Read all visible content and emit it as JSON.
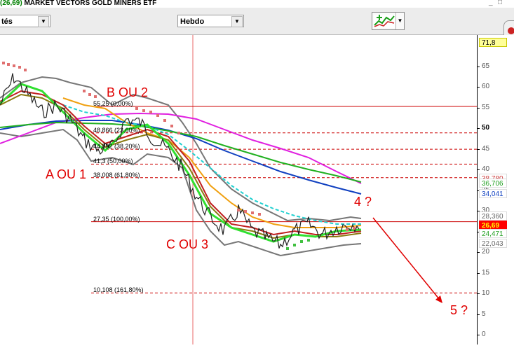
{
  "window": {
    "price": "(26,69)",
    "title": "MARKET VECTORS GOLD MINERS ETF",
    "minimize": "_",
    "close": "□"
  },
  "toolbar": {
    "left_combo_value": "tés",
    "period_combo_value": "Hebdo",
    "arrow_glyph": "▼"
  },
  "axis": {
    "ticks": [
      "65",
      "60",
      "55",
      "50",
      "45",
      "40",
      "35",
      "30",
      "25",
      "20",
      "15",
      "10",
      "5",
      "0"
    ],
    "bold_tick": "50"
  },
  "price_labels": {
    "max": "71,8",
    "ma1": "36,706",
    "ma2": "34,041",
    "ma3": "38,780",
    "band_up": "28,360",
    "last": "26,69",
    "ma4": "24,471",
    "band_low": "22,043"
  },
  "fib_levels": [
    {
      "label": "55,25 (0,00%)",
      "value": 55.25,
      "style": "solid"
    },
    {
      "label": "48,866 (23,60%)",
      "value": 48.866,
      "style": "dashed"
    },
    {
      "label": "44,892 (38,20%)",
      "value": 44.892,
      "style": "dashed"
    },
    {
      "label": "41,3 (50,00%)",
      "value": 41.3,
      "style": "dashed"
    },
    {
      "label": "38,008 (61,80%)",
      "value": 38.008,
      "style": "dashed"
    },
    {
      "label": "27,35 (100,00%)",
      "value": 27.35,
      "style": "solid"
    },
    {
      "label": "10,108 (161,80%)",
      "value": 10.108,
      "style": "dashed"
    }
  ],
  "annotations": {
    "wave_a": "A OU 1",
    "wave_b": "B OU 2",
    "wave_c": "C OU 3",
    "wave_4": "4 ?",
    "wave_5": "5 ?"
  },
  "colors": {
    "price_green": "#008000",
    "annotation_red": "#e00000",
    "fib_red": "#cc0000",
    "last_price_bg": "#ff0000",
    "last_price_fg": "#ffff00"
  }
}
